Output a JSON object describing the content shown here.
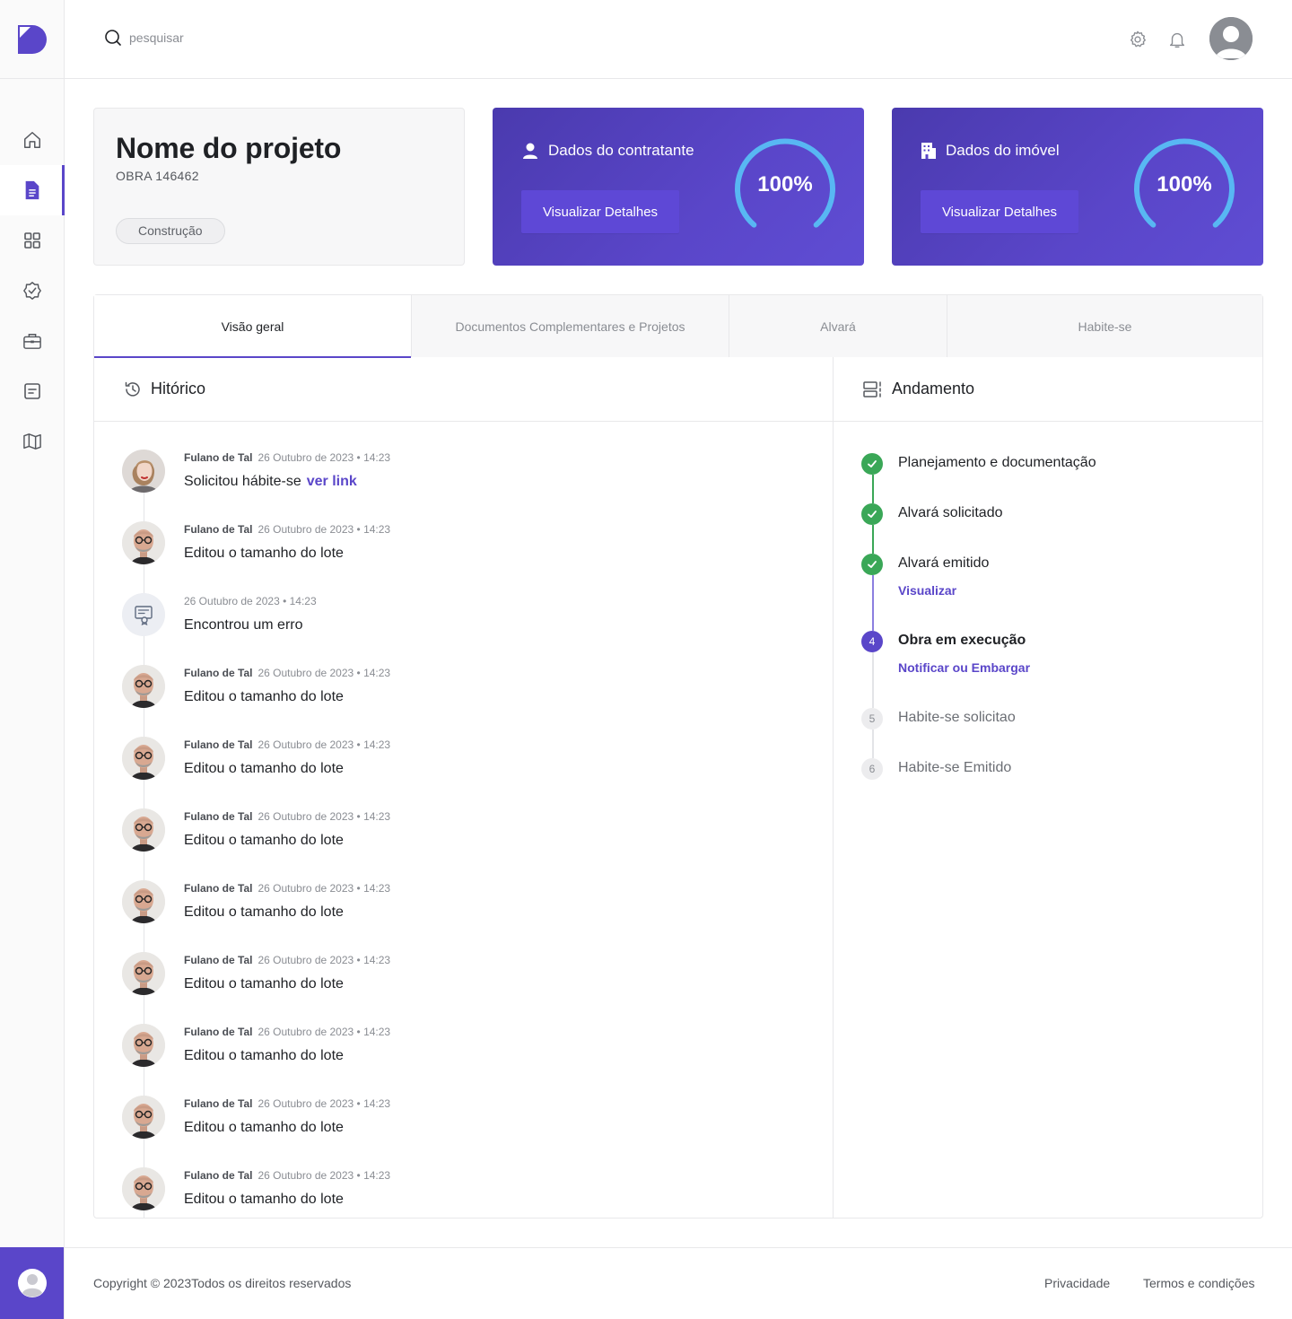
{
  "search": {
    "placeholder": "pesquisar"
  },
  "icons": {
    "logo": "app-logo-icon",
    "nav": [
      "home-icon",
      "document-icon",
      "grid-icon",
      "badge-check-icon",
      "briefcase-icon",
      "list-icon",
      "map-icon"
    ],
    "header": [
      "settings-icon",
      "bell-icon",
      "user-avatar-icon"
    ]
  },
  "colors": {
    "accent": "#5a46c9",
    "success": "#3aa757",
    "gauge": "#58b7f3"
  },
  "project": {
    "title": "Nome do projeto",
    "code": "OBRA 146462",
    "tag": "Construção"
  },
  "cards": [
    {
      "title": "Dados do contratante",
      "icon": "user-icon",
      "button": "Visualizar Detalhes",
      "percent_label": "100%",
      "percent": 1.0
    },
    {
      "title": "Dados do imóvel",
      "icon": "building-icon",
      "button": "Visualizar Detalhes",
      "percent_label": "100%",
      "percent": 1.0
    }
  ],
  "tabs": [
    "Visão geral",
    "Documentos Complementares e Projetos",
    "Alvará",
    "Habite-se"
  ],
  "history": {
    "title": "Hitórico",
    "items": [
      {
        "name": "Fulano de Tal",
        "date": "26 Outubro de 2023 • 14:23",
        "text": "Solicitou hábite-se",
        "link": "ver link",
        "avatar": "woman"
      },
      {
        "name": "Fulano de Tal",
        "date": "26 Outubro de 2023 • 14:23",
        "text": "Editou o tamanho do lote",
        "avatar": "man"
      },
      {
        "name": "",
        "date": "26 Outubro de 2023 • 14:23",
        "text": "Encontrou um erro",
        "avatar": "system"
      },
      {
        "name": "Fulano de Tal",
        "date": "26 Outubro de 2023 • 14:23",
        "text": "Editou o tamanho do lote",
        "avatar": "man"
      },
      {
        "name": "Fulano de Tal",
        "date": "26 Outubro de 2023 • 14:23",
        "text": "Editou o tamanho do lote",
        "avatar": "man"
      },
      {
        "name": "Fulano de Tal",
        "date": "26 Outubro de 2023 • 14:23",
        "text": "Editou o tamanho do lote",
        "avatar": "man"
      },
      {
        "name": "Fulano de Tal",
        "date": "26 Outubro de 2023 • 14:23",
        "text": "Editou o tamanho do lote",
        "avatar": "man"
      },
      {
        "name": "Fulano de Tal",
        "date": "26 Outubro de 2023 • 14:23",
        "text": "Editou o tamanho do lote",
        "avatar": "man"
      },
      {
        "name": "Fulano de Tal",
        "date": "26 Outubro de 2023 • 14:23",
        "text": "Editou o tamanho do lote",
        "avatar": "man"
      },
      {
        "name": "Fulano de Tal",
        "date": "26 Outubro de 2023 • 14:23",
        "text": "Editou o tamanho do lote",
        "avatar": "man"
      },
      {
        "name": "Fulano de Tal",
        "date": "26 Outubro de 2023 • 14:23",
        "text": "Editou o tamanho do lote",
        "avatar": "man"
      }
    ]
  },
  "progress": {
    "title": "Andamento",
    "steps": [
      {
        "label": "Planejamento e documentação",
        "status": "done"
      },
      {
        "label": "Alvará solicitado",
        "status": "done"
      },
      {
        "label": "Alvará emitido",
        "status": "done",
        "action": "Visualizar"
      },
      {
        "label": "Obra em execução",
        "status": "current",
        "number": "4",
        "action": "Notificar ou Embargar"
      },
      {
        "label": "Habite-se solicitao",
        "status": "todo",
        "number": "5"
      },
      {
        "label": "Habite-se Emitido",
        "status": "todo",
        "number": "6"
      }
    ]
  },
  "footer": {
    "copyright": "Copyright © 2023Todos os direitos reservados",
    "links": [
      "Privacidade",
      "Termos e condições"
    ]
  }
}
